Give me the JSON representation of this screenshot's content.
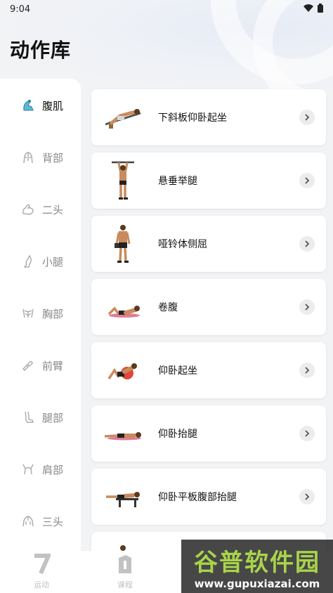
{
  "status_bar": {
    "time": "9:04"
  },
  "page_title": "动作库",
  "sidebar": {
    "items": [
      {
        "label": "腹肌",
        "icon": "abs-icon",
        "active": true
      },
      {
        "label": "背部",
        "icon": "back-icon",
        "active": false
      },
      {
        "label": "二头",
        "icon": "biceps-icon",
        "active": false
      },
      {
        "label": "小腿",
        "icon": "calf-icon",
        "active": false
      },
      {
        "label": "胸部",
        "icon": "chest-icon",
        "active": false
      },
      {
        "label": "前臂",
        "icon": "forearm-icon",
        "active": false
      },
      {
        "label": "腿部",
        "icon": "leg-icon",
        "active": false
      },
      {
        "label": "肩部",
        "icon": "shoulder-icon",
        "active": false
      },
      {
        "label": "三头",
        "icon": "triceps-icon",
        "active": false
      }
    ]
  },
  "exercises": [
    {
      "label": "下斜板仰卧起坐",
      "icon": "decline-situp-image"
    },
    {
      "label": "悬垂举腿",
      "icon": "hanging-leg-raise-image"
    },
    {
      "label": "哑铃体侧屈",
      "icon": "dumbbell-side-bend-image"
    },
    {
      "label": "卷腹",
      "icon": "crunch-image"
    },
    {
      "label": "仰卧起坐",
      "icon": "situp-image"
    },
    {
      "label": "仰卧抬腿",
      "icon": "lying-leg-raise-image"
    },
    {
      "label": "仰卧平板腹部抬腿",
      "icon": "flat-bench-leg-raise-image"
    }
  ],
  "bottom_nav": {
    "items": [
      {
        "label": "运动",
        "icon": "workout-icon"
      },
      {
        "label": "课程",
        "icon": "course-icon"
      }
    ]
  },
  "watermark": {
    "title": "谷普软件园",
    "url": "www.gupuxiazai.com"
  },
  "colors": {
    "background": "#f2f3f5",
    "card": "#ffffff",
    "watermark_green": "#a8d44a"
  }
}
